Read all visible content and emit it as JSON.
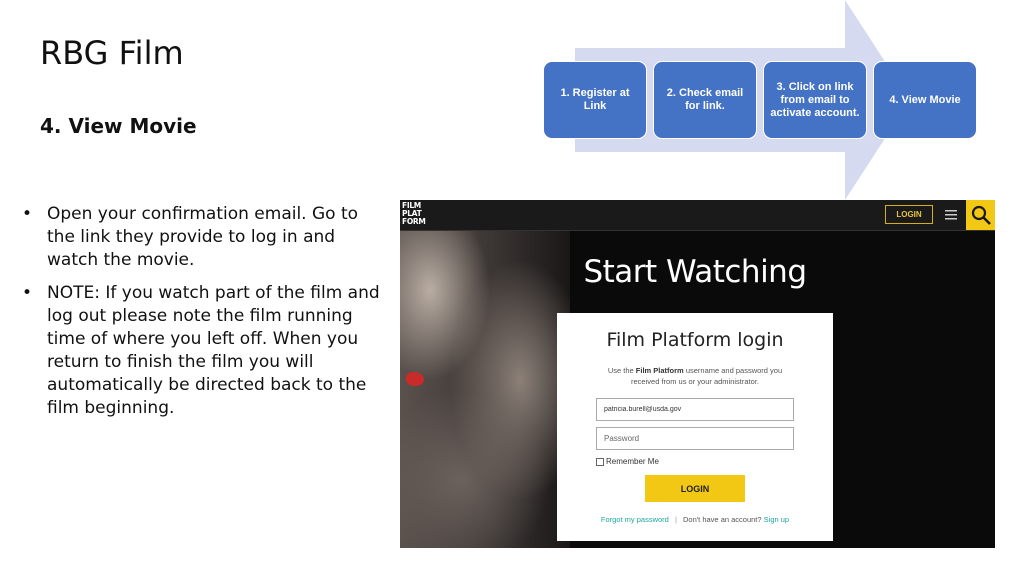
{
  "slide": {
    "title": "RBG Film",
    "subtitle": "4. View Movie",
    "bullets": [
      "Open your confirmation email. Go to the link they provide to log in and watch the movie.",
      "NOTE: If you watch part of the film and log out please note the film running time of where you left off.  When you return to finish the film you will automatically be directed back to the film beginning."
    ]
  },
  "process": {
    "steps": [
      "1. Register at Link",
      "2. Check email for link.",
      "3. Click on link from email to activate account.",
      "4. View Movie"
    ],
    "step_color": "#4472c4",
    "arrow_color": "#d5daf0"
  },
  "screenshot": {
    "logo_lines": [
      "FILM",
      "PLAT",
      "FORM"
    ],
    "nav": {
      "login_label": "LOGIN",
      "menu_icon": "hamburger-menu-icon",
      "search_icon": "search-icon"
    },
    "hero_title": "Start Watching",
    "login_card": {
      "title": "Film Platform login",
      "desc_before": "Use the ",
      "desc_bold": "Film Platform",
      "desc_after": " username and password you received from us or your administrator.",
      "email_value": "patricia.burell@usda.gov",
      "password_placeholder": "Password",
      "remember_label": "Remember Me",
      "login_button": "LOGIN",
      "forgot_link": "Forgot my password",
      "divider": "|",
      "no_account": "Don't have an account?",
      "signup_link": "Sign up"
    },
    "accent_color": "#f2c814",
    "link_color": "#1aa7a0"
  }
}
